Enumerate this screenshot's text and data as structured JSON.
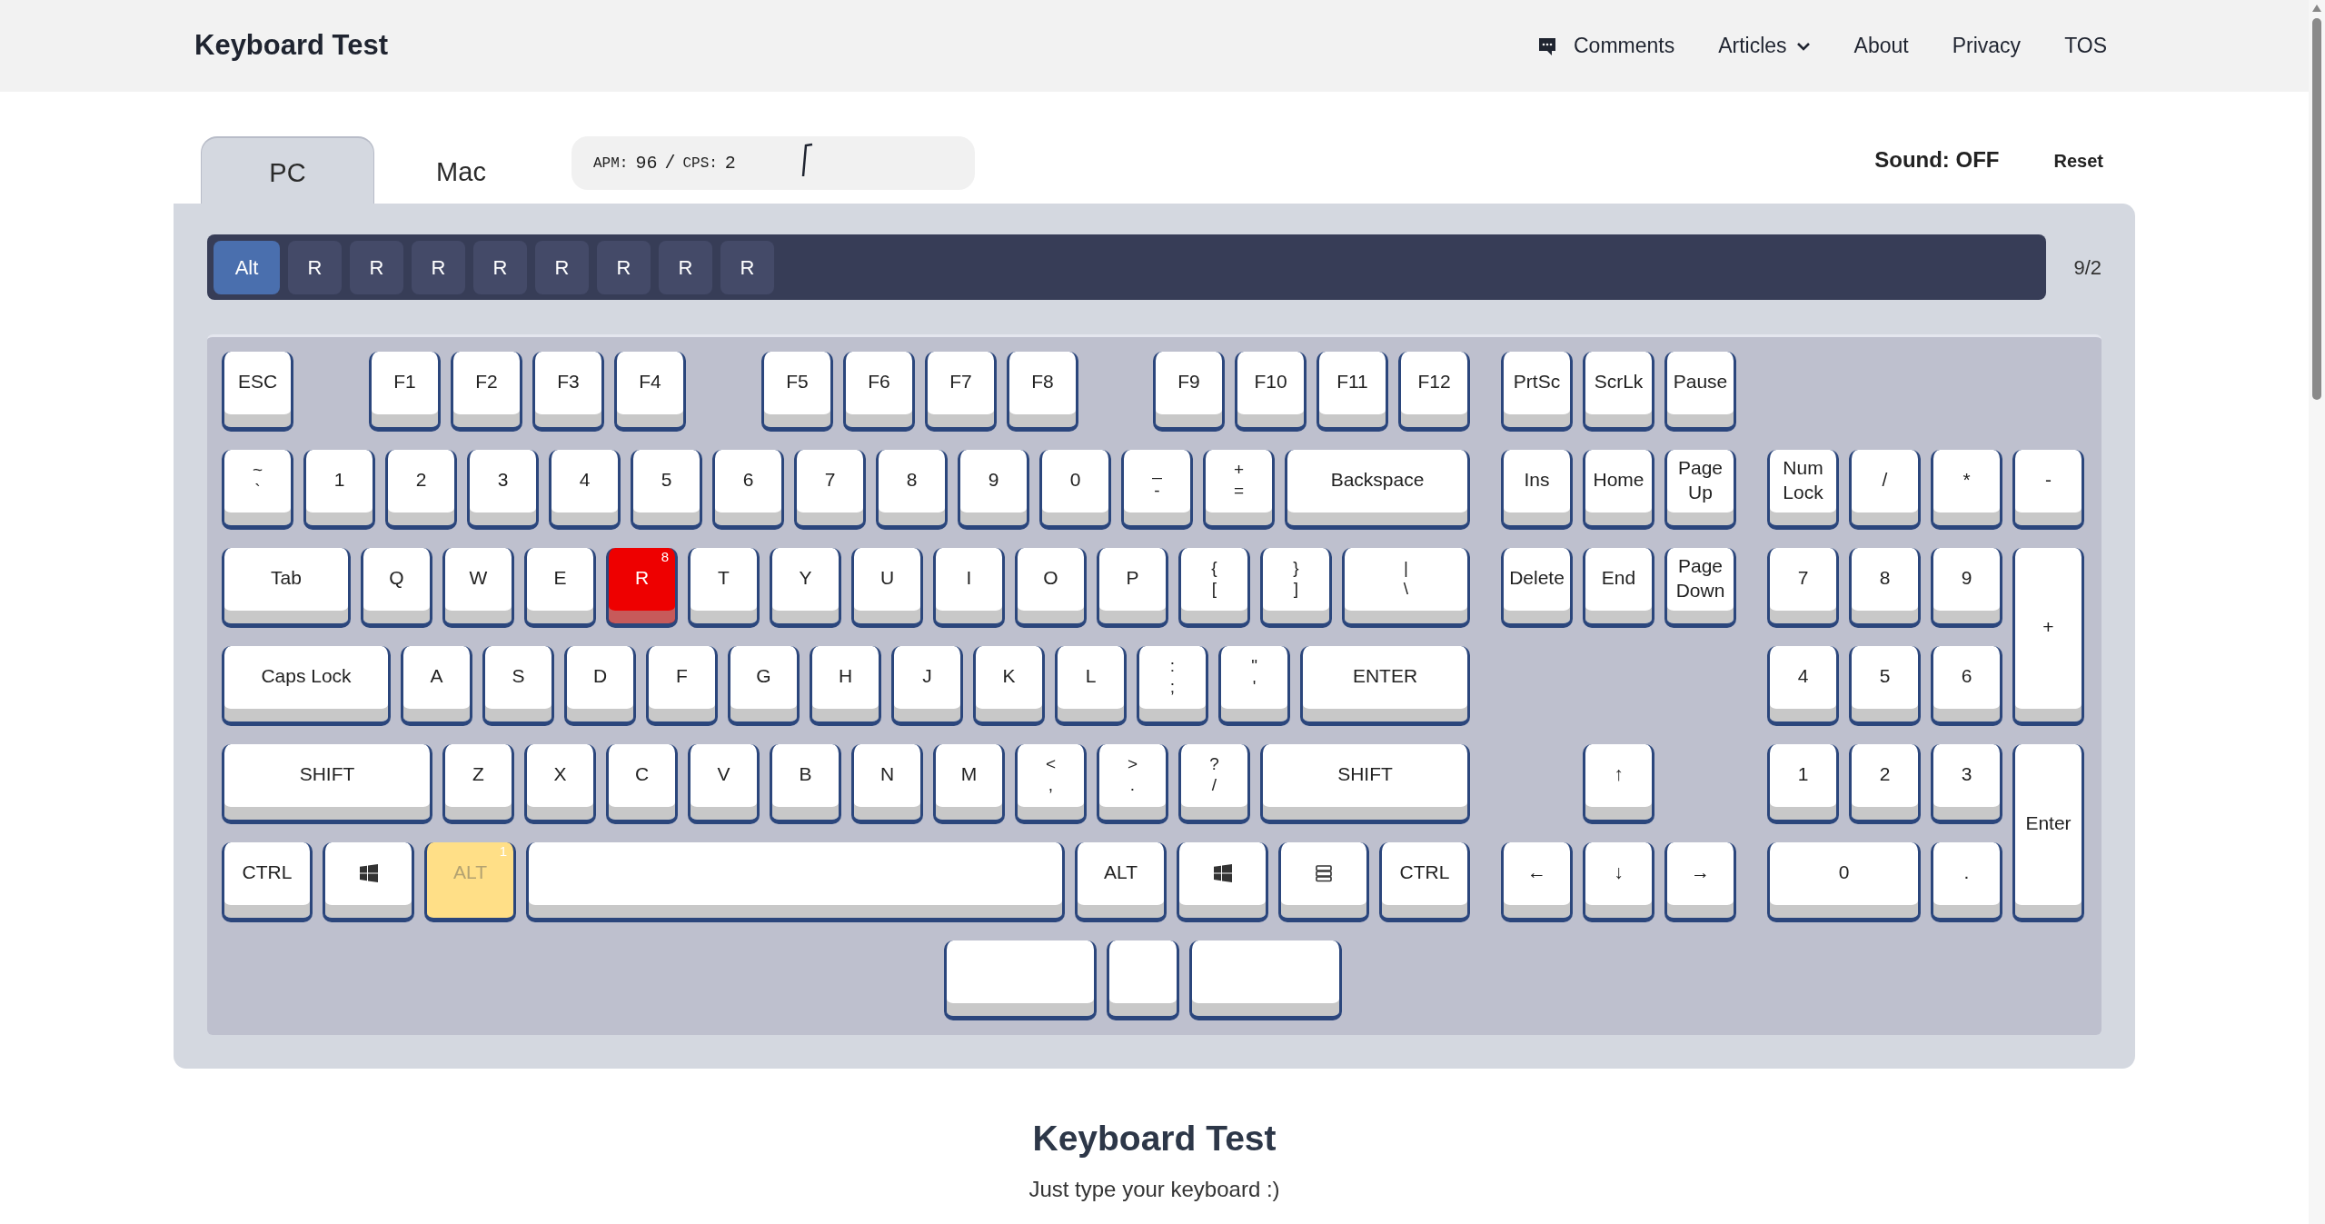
{
  "header": {
    "title": "Keyboard Test",
    "nav": [
      {
        "label": "Comments",
        "kind": "comments"
      },
      {
        "label": "Articles",
        "kind": "dropdown"
      },
      {
        "label": "About",
        "kind": "link"
      },
      {
        "label": "Privacy",
        "kind": "link"
      },
      {
        "label": "TOS",
        "kind": "link"
      }
    ]
  },
  "tabs": [
    {
      "label": "PC",
      "selected": true
    },
    {
      "label": "Mac",
      "selected": false
    }
  ],
  "stats": {
    "apm_label": "APM:",
    "apm": "96",
    "separator": "/",
    "cps_label": "CPS:",
    "cps": "2"
  },
  "sound": "Sound: OFF",
  "reset": "Reset",
  "history": {
    "keys": [
      {
        "label": "Alt",
        "selected": true
      },
      {
        "label": "R",
        "selected": false
      },
      {
        "label": "R",
        "selected": false
      },
      {
        "label": "R",
        "selected": false
      },
      {
        "label": "R",
        "selected": false
      },
      {
        "label": "R",
        "selected": false
      },
      {
        "label": "R",
        "selected": false
      },
      {
        "label": "R",
        "selected": false
      },
      {
        "label": "R",
        "selected": false
      }
    ],
    "count": "9/2"
  },
  "keyboard": {
    "main": [
      [
        {
          "kind": "text",
          "label": "ESC",
          "pressed": false,
          "current": false
        },
        {
          "kind": "text",
          "label": "F1",
          "pressed": false,
          "current": false
        },
        {
          "kind": "text",
          "label": "F2",
          "pressed": false,
          "current": false
        },
        {
          "kind": "text",
          "label": "F3",
          "pressed": false,
          "current": false
        },
        {
          "kind": "text",
          "label": "F4",
          "pressed": false,
          "current": false
        },
        {
          "kind": "text",
          "label": "F5",
          "pressed": false,
          "current": false
        },
        {
          "kind": "text",
          "label": "F6",
          "pressed": false,
          "current": false
        },
        {
          "kind": "text",
          "label": "F7",
          "pressed": false,
          "current": false
        },
        {
          "kind": "text",
          "label": "F8",
          "pressed": false,
          "current": false
        },
        {
          "kind": "text",
          "label": "F9",
          "pressed": false,
          "current": false
        },
        {
          "kind": "text",
          "label": "F10",
          "pressed": false,
          "current": false
        },
        {
          "kind": "text",
          "label": "F11",
          "pressed": false,
          "current": false
        },
        {
          "kind": "text",
          "label": "F12",
          "pressed": false,
          "current": false
        }
      ],
      [
        {
          "kind": "dual",
          "legends": [
            "~",
            "`"
          ],
          "pressed": false,
          "current": false
        },
        {
          "kind": "text",
          "label": "1",
          "pressed": false,
          "current": false
        },
        {
          "kind": "text",
          "label": "2",
          "pressed": false,
          "current": false
        },
        {
          "kind": "text",
          "label": "3",
          "pressed": false,
          "current": false
        },
        {
          "kind": "text",
          "label": "4",
          "pressed": false,
          "current": false
        },
        {
          "kind": "text",
          "label": "5",
          "pressed": false,
          "current": false
        },
        {
          "kind": "text",
          "label": "6",
          "pressed": false,
          "current": false
        },
        {
          "kind": "text",
          "label": "7",
          "pressed": false,
          "current": false
        },
        {
          "kind": "text",
          "label": "8",
          "pressed": false,
          "current": false
        },
        {
          "kind": "text",
          "label": "9",
          "pressed": false,
          "current": false
        },
        {
          "kind": "text",
          "label": "0",
          "pressed": false,
          "current": false
        },
        {
          "kind": "dual",
          "legends": [
            "_",
            "-"
          ],
          "pressed": false,
          "current": false
        },
        {
          "kind": "dual",
          "legends": [
            "+",
            "="
          ],
          "pressed": false,
          "current": false
        },
        {
          "kind": "text",
          "label": "Backspace",
          "pressed": false,
          "current": false
        }
      ],
      [
        {
          "kind": "text",
          "label": "Tab",
          "pressed": false,
          "current": false
        },
        {
          "kind": "text",
          "label": "Q",
          "pressed": false,
          "current": false
        },
        {
          "kind": "text",
          "label": "W",
          "pressed": false,
          "current": false
        },
        {
          "kind": "text",
          "label": "E",
          "pressed": false,
          "current": false
        },
        {
          "kind": "text",
          "label": "R",
          "pressed": false,
          "current": true,
          "count": "8"
        },
        {
          "kind": "text",
          "label": "T",
          "pressed": false,
          "current": false
        },
        {
          "kind": "text",
          "label": "Y",
          "pressed": false,
          "current": false
        },
        {
          "kind": "text",
          "label": "U",
          "pressed": false,
          "current": false
        },
        {
          "kind": "text",
          "label": "I",
          "pressed": false,
          "current": false
        },
        {
          "kind": "text",
          "label": "O",
          "pressed": false,
          "current": false
        },
        {
          "kind": "text",
          "label": "P",
          "pressed": false,
          "current": false
        },
        {
          "kind": "dual",
          "legends": [
            "{",
            "["
          ],
          "pressed": false,
          "current": false
        },
        {
          "kind": "dual",
          "legends": [
            "}",
            "]"
          ],
          "pressed": false,
          "current": false
        },
        {
          "kind": "dual",
          "legends": [
            "|",
            "\\"
          ],
          "pressed": false,
          "current": false
        }
      ],
      [
        {
          "kind": "text",
          "label": "Caps Lock",
          "pressed": false,
          "current": false
        },
        {
          "kind": "text",
          "label": "A",
          "pressed": false,
          "current": false
        },
        {
          "kind": "text",
          "label": "S",
          "pressed": false,
          "current": false
        },
        {
          "kind": "text",
          "label": "D",
          "pressed": false,
          "current": false
        },
        {
          "kind": "text",
          "label": "F",
          "pressed": false,
          "current": false
        },
        {
          "kind": "text",
          "label": "G",
          "pressed": false,
          "current": false
        },
        {
          "kind": "text",
          "label": "H",
          "pressed": false,
          "current": false
        },
        {
          "kind": "text",
          "label": "J",
          "pressed": false,
          "current": false
        },
        {
          "kind": "text",
          "label": "K",
          "pressed": false,
          "current": false
        },
        {
          "kind": "text",
          "label": "L",
          "pressed": false,
          "current": false
        },
        {
          "kind": "dual",
          "legends": [
            ":",
            ";"
          ],
          "pressed": false,
          "current": false
        },
        {
          "kind": "dual",
          "legends": [
            "\"",
            "'"
          ],
          "pressed": false,
          "current": false
        },
        {
          "kind": "text",
          "label": "ENTER",
          "pressed": false,
          "current": false
        }
      ],
      [
        {
          "kind": "text",
          "label": "SHIFT",
          "pressed": false,
          "current": false
        },
        {
          "kind": "text",
          "label": "Z",
          "pressed": false,
          "current": false
        },
        {
          "kind": "text",
          "label": "X",
          "pressed": false,
          "current": false
        },
        {
          "kind": "text",
          "label": "C",
          "pressed": false,
          "current": false
        },
        {
          "kind": "text",
          "label": "V",
          "pressed": false,
          "current": false
        },
        {
          "kind": "text",
          "label": "B",
          "pressed": false,
          "current": false
        },
        {
          "kind": "text",
          "label": "N",
          "pressed": false,
          "current": false
        },
        {
          "kind": "text",
          "label": "M",
          "pressed": false,
          "current": false
        },
        {
          "kind": "dual",
          "legends": [
            "<",
            ","
          ],
          "pressed": false,
          "current": false
        },
        {
          "kind": "dual",
          "legends": [
            ">",
            "."
          ],
          "pressed": false,
          "current": false
        },
        {
          "kind": "dual",
          "legends": [
            "?",
            "/"
          ],
          "pressed": false,
          "current": false
        },
        {
          "kind": "text",
          "label": "SHIFT",
          "pressed": false,
          "current": false
        }
      ],
      [
        {
          "kind": "text",
          "label": "CTRL",
          "pressed": false,
          "current": false
        },
        {
          "kind": "windows",
          "pressed": false,
          "current": false
        },
        {
          "kind": "text",
          "label": "ALT",
          "pressed": true,
          "current": false,
          "count": "1"
        },
        {
          "kind": "blank",
          "pressed": false,
          "current": false
        },
        {
          "kind": "text",
          "label": "ALT",
          "pressed": false,
          "current": false
        },
        {
          "kind": "windows",
          "pressed": false,
          "current": false
        },
        {
          "kind": "menu",
          "pressed": false,
          "current": false
        },
        {
          "kind": "text",
          "label": "CTRL",
          "pressed": false,
          "current": false
        }
      ],
      [
        {
          "kind": "blank",
          "pressed": false,
          "current": false
        },
        {
          "kind": "blank",
          "pressed": false,
          "current": false
        },
        {
          "kind": "blank",
          "pressed": false,
          "current": false
        }
      ]
    ],
    "nav": [
      [
        {
          "kind": "text",
          "label": "PrtSc",
          "pressed": false,
          "current": false
        },
        {
          "kind": "text",
          "label": "ScrLk",
          "pressed": false,
          "current": false
        },
        {
          "kind": "text",
          "label": "Pause",
          "pressed": false,
          "current": false
        }
      ],
      [
        {
          "kind": "text",
          "label": "Ins",
          "pressed": false,
          "current": false
        },
        {
          "kind": "text",
          "label": "Home",
          "pressed": false,
          "current": false
        },
        {
          "kind": "text",
          "label": "Page Up",
          "pressed": false,
          "current": false
        }
      ],
      [
        {
          "kind": "text",
          "label": "Delete",
          "pressed": false,
          "current": false
        },
        {
          "kind": "text",
          "label": "End",
          "pressed": false,
          "current": false
        },
        {
          "kind": "text",
          "label": "Page Down",
          "pressed": false,
          "current": false
        }
      ],
      [
        {
          "kind": "text",
          "label": "↑",
          "pressed": false,
          "current": false
        }
      ],
      [
        {
          "kind": "text",
          "label": "←",
          "pressed": false,
          "current": false
        },
        {
          "kind": "text",
          "label": "↓",
          "pressed": false,
          "current": false
        },
        {
          "kind": "text",
          "label": "→",
          "pressed": false,
          "current": false
        }
      ]
    ],
    "numpad": [
      [
        {
          "kind": "text",
          "label": "Num Lock",
          "pressed": false,
          "current": false
        },
        {
          "kind": "text",
          "label": "/",
          "pressed": false,
          "current": false
        },
        {
          "kind": "text",
          "label": "*",
          "pressed": false,
          "current": false
        },
        {
          "kind": "text",
          "label": "-",
          "pressed": false,
          "current": false
        }
      ],
      [
        {
          "kind": "text",
          "label": "7",
          "pressed": false,
          "current": false
        },
        {
          "kind": "text",
          "label": "8",
          "pressed": false,
          "current": false
        },
        {
          "kind": "text",
          "label": "9",
          "pressed": false,
          "current": false
        },
        {
          "kind": "text",
          "label": "+",
          "pressed": false,
          "current": false
        }
      ],
      [
        {
          "kind": "text",
          "label": "4",
          "pressed": false,
          "current": false
        },
        {
          "kind": "text",
          "label": "5",
          "pressed": false,
          "current": false
        },
        {
          "kind": "text",
          "label": "6",
          "pressed": false,
          "current": false
        }
      ],
      [
        {
          "kind": "text",
          "label": "1",
          "pressed": false,
          "current": false
        },
        {
          "kind": "text",
          "label": "2",
          "pressed": false,
          "current": false
        },
        {
          "kind": "text",
          "label": "3",
          "pressed": false,
          "current": false
        },
        {
          "kind": "text",
          "label": "Enter",
          "pressed": false,
          "current": false
        }
      ],
      [
        {
          "kind": "text",
          "label": "0",
          "pressed": false,
          "current": false
        },
        {
          "kind": "text",
          "label": ".",
          "pressed": false,
          "current": false
        }
      ]
    ]
  },
  "footer": {
    "title": "Keyboard Test",
    "subtitle": "Just type your keyboard :)"
  }
}
